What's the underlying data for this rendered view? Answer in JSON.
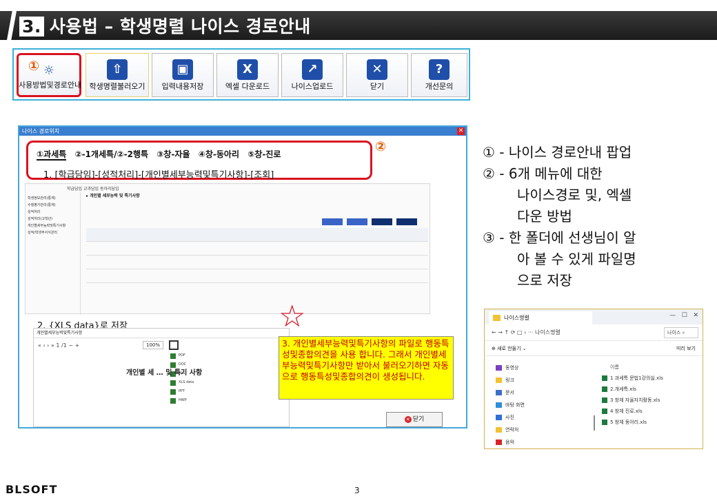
{
  "title": {
    "number": "3.",
    "text": "사용법 – 학생명렬 나이스 경로안내"
  },
  "toolbar": {
    "badge": "①",
    "buttons": [
      {
        "label": "사용방법및경로안내",
        "icon": "lightbulb-icon",
        "glyph": "☼"
      },
      {
        "label": "학생명렬불러오기",
        "icon": "upload-icon",
        "glyph": "⇧"
      },
      {
        "label": "입력내용저장",
        "icon": "save-icon",
        "glyph": "▣"
      },
      {
        "label": "엑셀 다운로드",
        "icon": "excel-icon",
        "glyph": "X"
      },
      {
        "label": "나이스업로드",
        "icon": "export-icon",
        "glyph": "↗"
      },
      {
        "label": "닫기",
        "icon": "close-icon",
        "glyph": "✕"
      },
      {
        "label": "개선문의",
        "icon": "question-icon",
        "glyph": "?"
      }
    ]
  },
  "popup": {
    "window_title": "나이스 경로위치",
    "badge": "②",
    "tabs": [
      "①과세특",
      "②-1개세특/②-2행특",
      "③창-자율",
      "④창-동아리",
      "⑤창-진로"
    ],
    "path": "1. [학급담임]-[성적처리]-[개인별세부능력및특기사항]-[조회]",
    "neis": {
      "top_tabs": "학급담임   교과담임   동아리담임",
      "heading": "▸ 개인별 세부능력 및 특기사항",
      "side_items": [
        "학생정보관리(통계)",
        "수행평가관리(통계)",
        "성적처리",
        "성적처리(고학년)",
        "개인별세부능력및특기사항",
        "성적/학생부서식관리"
      ]
    },
    "section2": "2. {XLS data}로 저장",
    "xls": {
      "bar_title": "개인별세부능력및특기사항",
      "toolbar_text": "«  ‹  ›  »     1  /1     −  +",
      "zoom": "100%",
      "menu_items": [
        "PDF",
        "DOC",
        "XLS",
        "XLS data",
        "PPT",
        "HWP"
      ],
      "doc_title": "개인별  세  …  및 특기 사항"
    },
    "note3": "3. 개인별세부능력및특기사항의 파일로 행동특성및종합의견을 사용 합니다. 그래서 개인별세부능력및특기사항만 받아서 불러오기하면 자동으로 행동특성및종합의견이 생성됩니다.",
    "close_button": "닫기"
  },
  "explain": {
    "line1": "① - 나이스 경로안내 팝업",
    "line2": "② - 6개 메뉴에 대한",
    "line3": "나이스경로 및, 엑셀",
    "line4": "다운 방법",
    "line5": "③ - 한 폴더에 선생님이 알",
    "line6": "아 볼 수 있게 파일명",
    "line7": "으로 저장"
  },
  "explorer": {
    "tab_title": "나이스명렬",
    "address": "←   →   ↑   ⟳   □  ›  ···  나이스명렬",
    "search_placeholder": "나이스 ⌕",
    "new_button": "⊕ 새로 만들기 ⌄",
    "view_button": "미리 보기",
    "left_items": [
      {
        "label": "동영상",
        "color": "#7b3fbf"
      },
      {
        "label": "링크",
        "color": "#f2c232"
      },
      {
        "label": "문서",
        "color": "#3a6fc8"
      },
      {
        "label": "바탕 화면",
        "color": "#2e8fd6"
      },
      {
        "label": "사진",
        "color": "#2e6fd6"
      },
      {
        "label": "연락처",
        "color": "#f2c232"
      },
      {
        "label": "음악",
        "color": "#d9232a"
      }
    ],
    "column_header": "이름",
    "files": [
      "1 과세특 문법1강의실.xls",
      "2.개세특.xls",
      "3 창체 자율자치활동.xls",
      "4 창체 진로.xls",
      "5 창체 동아리.xls"
    ]
  },
  "footer": {
    "logo": "BLSOFT",
    "page": "3"
  }
}
